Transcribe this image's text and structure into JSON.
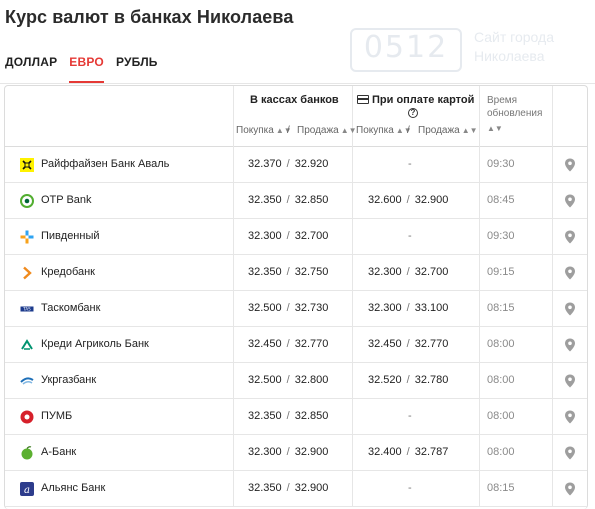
{
  "page": {
    "title": "Курс валют в банках Николаева"
  },
  "watermark": {
    "number": "0512",
    "line1": "Сайт города",
    "line2": "Николаева"
  },
  "tabs": [
    {
      "label": "ДОЛЛАР",
      "active": false
    },
    {
      "label": "ЕВРО",
      "active": true
    },
    {
      "label": "РУБЛЬ",
      "active": false
    }
  ],
  "table": {
    "group_cash": "В кассах банков",
    "group_card": "При оплате картой",
    "buy_label": "Покупка",
    "sell_label": "Продажа",
    "time_label_1": "Время",
    "time_label_2": "обновления",
    "rows": [
      {
        "bank": "Райффайзен Банк Аваль",
        "logo": "raiffeisen-logo",
        "cash_buy": "32.370",
        "cash_sell": "32.920",
        "card_buy": "",
        "card_sell": "",
        "card_dash": "-",
        "time": "09:30"
      },
      {
        "bank": "OTP Bank",
        "logo": "otp-logo",
        "cash_buy": "32.350",
        "cash_sell": "32.850",
        "card_buy": "32.600",
        "card_sell": "32.900",
        "card_dash": "",
        "time": "08:45"
      },
      {
        "bank": "Пивденный",
        "logo": "pivdenny-logo",
        "cash_buy": "32.300",
        "cash_sell": "32.700",
        "card_buy": "",
        "card_sell": "",
        "card_dash": "-",
        "time": "09:30"
      },
      {
        "bank": "Кредобанк",
        "logo": "kredobank-logo",
        "cash_buy": "32.350",
        "cash_sell": "32.750",
        "card_buy": "32.300",
        "card_sell": "32.700",
        "card_dash": "",
        "time": "09:15"
      },
      {
        "bank": "Таскомбанк",
        "logo": "taskombank-logo",
        "cash_buy": "32.500",
        "cash_sell": "32.730",
        "card_buy": "32.300",
        "card_sell": "33.100",
        "card_dash": "",
        "time": "08:15"
      },
      {
        "bank": "Креди Агриколь Банк",
        "logo": "credit-agricole-logo",
        "cash_buy": "32.450",
        "cash_sell": "32.770",
        "card_buy": "32.450",
        "card_sell": "32.770",
        "card_dash": "",
        "time": "08:00"
      },
      {
        "bank": "Укргазбанк",
        "logo": "ukrgasbank-logo",
        "cash_buy": "32.500",
        "cash_sell": "32.800",
        "card_buy": "32.520",
        "card_sell": "32.780",
        "card_dash": "",
        "time": "08:00"
      },
      {
        "bank": "ПУМБ",
        "logo": "pumb-logo",
        "cash_buy": "32.350",
        "cash_sell": "32.850",
        "card_buy": "",
        "card_sell": "",
        "card_dash": "-",
        "time": "08:00"
      },
      {
        "bank": "А-Банк",
        "logo": "a-bank-logo",
        "cash_buy": "32.300",
        "cash_sell": "32.900",
        "card_buy": "32.400",
        "card_sell": "32.787",
        "card_dash": "",
        "time": "08:00"
      },
      {
        "bank": "Альянс Банк",
        "logo": "alliance-bank-logo",
        "cash_buy": "32.350",
        "cash_sell": "32.900",
        "card_buy": "",
        "card_sell": "",
        "card_dash": "-",
        "time": "08:15"
      }
    ]
  },
  "colors": {
    "accent": "#e53935",
    "pin": "#9e9e9e"
  }
}
